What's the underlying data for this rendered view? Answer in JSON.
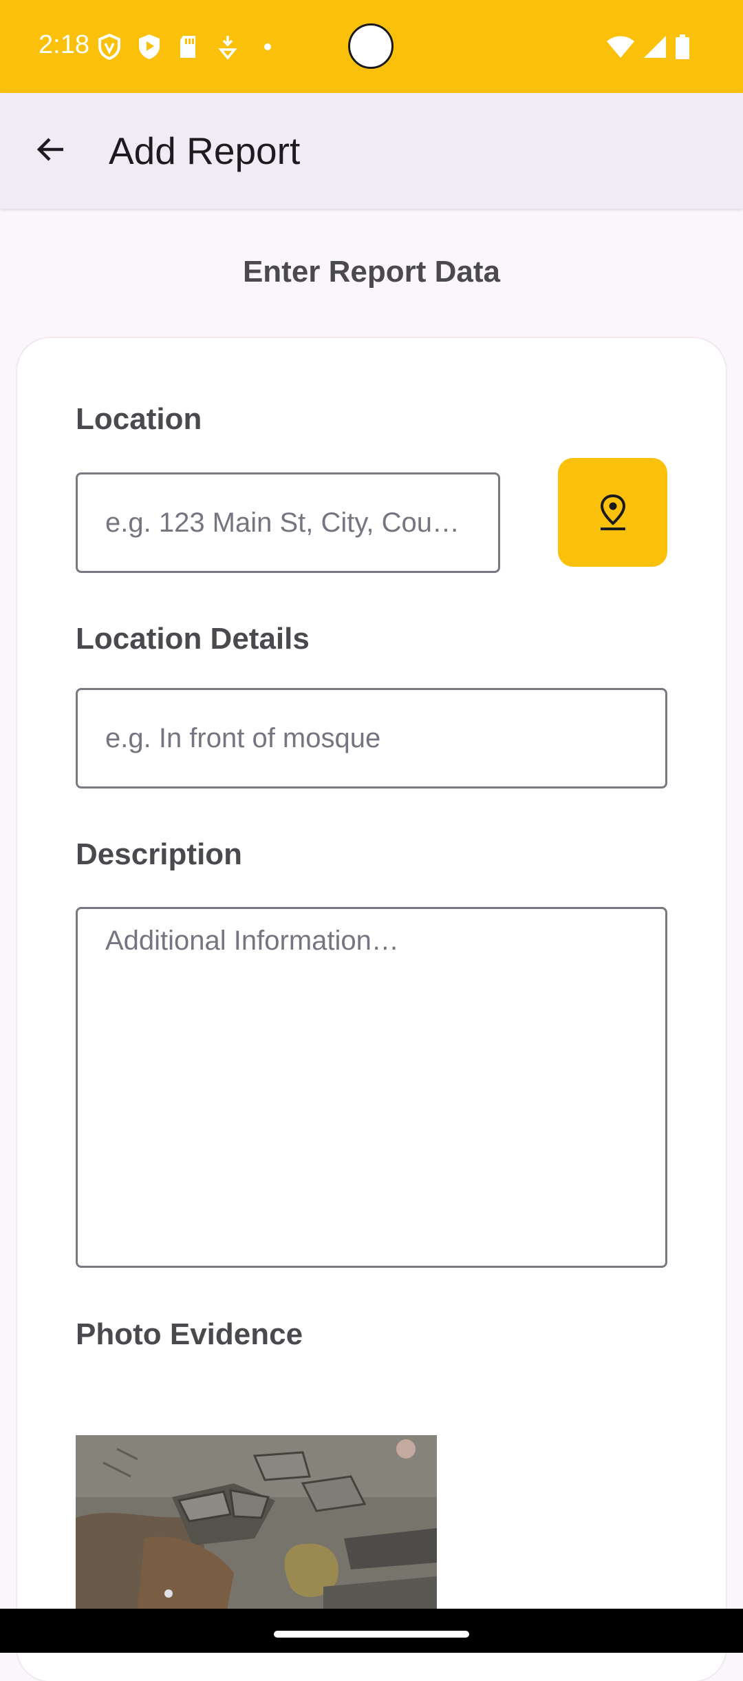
{
  "status_bar": {
    "time": "2:18",
    "background": "#fbc00a",
    "left_icons": [
      "vpn-shield-icon",
      "play-protect-icon",
      "sd-card-icon",
      "download-icon",
      "dot-icon"
    ],
    "right_icons": [
      "wifi-icon",
      "signal-icon",
      "battery-icon"
    ]
  },
  "app_bar": {
    "back_icon": "arrow-back-icon",
    "title": "Add Report"
  },
  "form": {
    "heading": "Enter Report Data",
    "location": {
      "label": "Location",
      "placeholder": "e.g. 123 Main St, City, Cou…",
      "value": "",
      "locate_icon": "location-pin-icon"
    },
    "location_details": {
      "label": "Location Details",
      "placeholder": "e.g. In front of mosque",
      "value": ""
    },
    "description": {
      "label": "Description",
      "placeholder": "Additional Information…",
      "value": ""
    },
    "photo_evidence": {
      "label": "Photo Evidence",
      "image": "damaged-road-photo"
    }
  },
  "colors": {
    "accent": "#fbc00a",
    "app_bar": "#f1ecf4",
    "page_background": "#fbf6fb"
  }
}
